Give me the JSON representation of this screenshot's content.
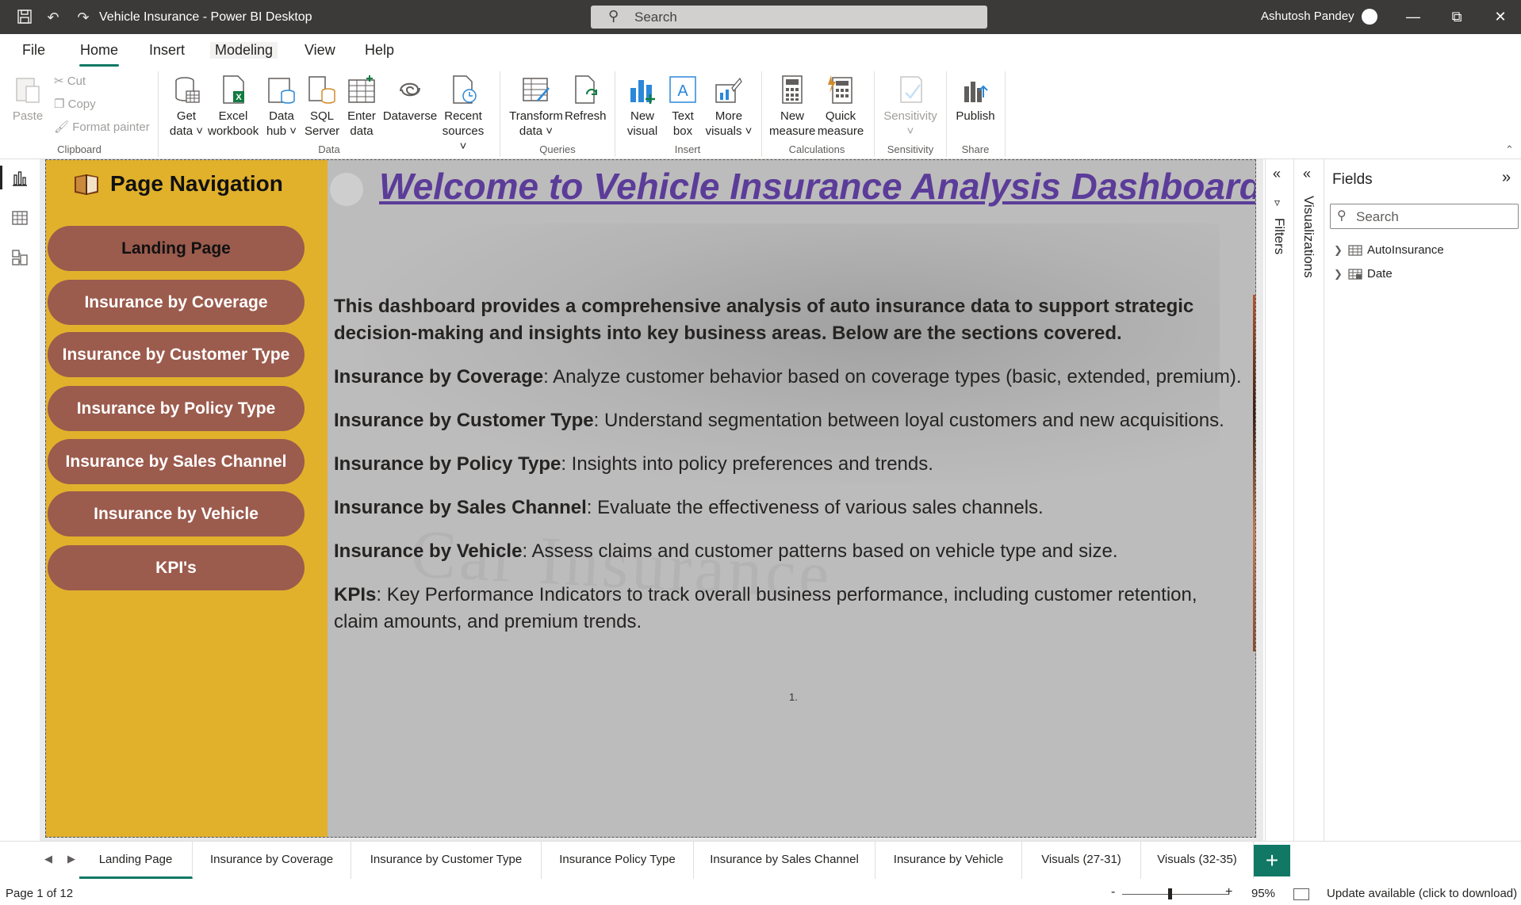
{
  "window": {
    "title": "Vehicle Insurance - Power BI Desktop",
    "search_placeholder": "Search",
    "user_name": "Ashutosh Pandey"
  },
  "menu": {
    "tabs": [
      "File",
      "Home",
      "Insert",
      "Modeling",
      "View",
      "Help"
    ],
    "active_tab": "Home"
  },
  "ribbon": {
    "clipboard": {
      "paste": "Paste",
      "cut": "Cut",
      "copy": "Copy",
      "format_painter": "Format painter",
      "group": "Clipboard"
    },
    "data": {
      "get_data": [
        "Get",
        "data"
      ],
      "excel": [
        "Excel",
        "workbook"
      ],
      "data_hub": [
        "Data",
        "hub"
      ],
      "sql": [
        "SQL",
        "Server"
      ],
      "enter": [
        "Enter",
        "data"
      ],
      "dataverse": "Dataverse",
      "recent": [
        "Recent",
        "sources"
      ],
      "group": "Data"
    },
    "queries": {
      "transform": [
        "Transform",
        "data"
      ],
      "refresh": "Refresh",
      "group": "Queries"
    },
    "insert": {
      "new_visual": [
        "New",
        "visual"
      ],
      "text_box": [
        "Text",
        "box"
      ],
      "more_visuals": [
        "More",
        "visuals"
      ],
      "group": "Insert"
    },
    "calculations": {
      "new_measure": [
        "New",
        "measure"
      ],
      "quick_measure": [
        "Quick",
        "measure"
      ],
      "group": "Calculations"
    },
    "sensitivity": {
      "label": "Sensitivity",
      "group": "Sensitivity"
    },
    "share": {
      "publish": "Publish",
      "group": "Share"
    }
  },
  "nav": {
    "title": "Page Navigation",
    "buttons": [
      "Landing Page",
      "Insurance by Coverage",
      "Insurance by Customer Type",
      "Insurance by Policy Type",
      "Insurance by Sales Channel",
      "Insurance by Vehicle",
      "KPI's"
    ]
  },
  "report": {
    "welcome": "Welcome to Vehicle Insurance Analysis Dashboard",
    "intro": "This dashboard provides a comprehensive analysis of auto insurance data to support strategic decision-making and insights into key business areas. Below are the sections covered.",
    "sections": [
      {
        "name": "Insurance by Coverage",
        "desc": ": Analyze customer behavior based on coverage types (basic, extended, premium)."
      },
      {
        "name": "Insurance by Customer Type",
        "desc": ": Understand segmentation between loyal customers and new acquisitions."
      },
      {
        "name": "Insurance by Policy Type",
        "desc": ": Insights into policy preferences and trends."
      },
      {
        "name": "Insurance by Sales Channel",
        "desc": ": Evaluate the effectiveness of various sales channels."
      },
      {
        "name": "Insurance by Vehicle",
        "desc": ": Assess claims and customer patterns based on vehicle type and size."
      },
      {
        "name": "KPIs",
        "desc": ": Key Performance Indicators to track overall business performance, including customer retention, claim amounts, and premium trends."
      }
    ],
    "footnote": "1.",
    "watermark": "Car Insurance"
  },
  "panes": {
    "filters": "Filters",
    "visualizations": "Visualizations",
    "fields_title": "Fields",
    "fields_search": "Search",
    "fields": [
      "AutoInsurance",
      "Date"
    ]
  },
  "page_tabs": {
    "tabs": [
      "Landing Page",
      "Insurance by Coverage",
      "Insurance by Customer Type",
      "Insurance Policy Type",
      "Insurance by Sales Channel",
      "Insurance by Vehicle",
      "Visuals (27-31)",
      "Visuals (32-35)"
    ],
    "active": "Landing Page",
    "add": "+"
  },
  "status": {
    "page": "Page 1 of 12",
    "zoom_minus": "-",
    "zoom_plus": "+",
    "zoom": "95%",
    "update": "Update available (click to download)"
  },
  "colors": {
    "nav_panel": "#e1b12c",
    "nav_button": "#9b5b4d",
    "welcome_text": "#5b3c99",
    "accent": "#117865"
  }
}
